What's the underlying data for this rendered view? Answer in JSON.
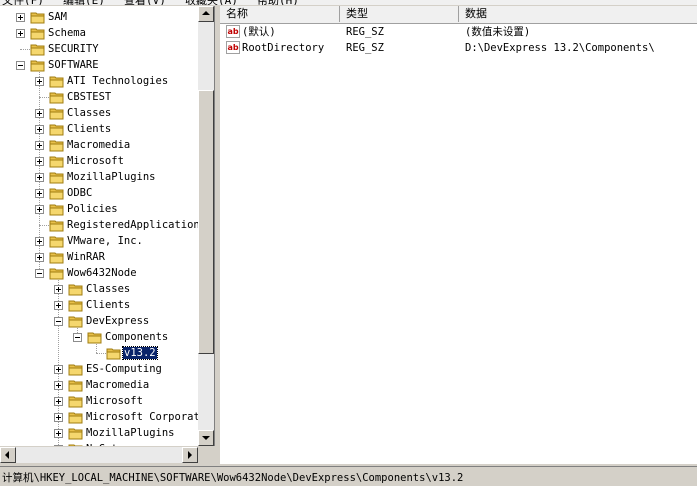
{
  "menubar": {
    "items": [
      "文件(F)",
      "编辑(E)",
      "查看(V)",
      "收藏夹(A)",
      "帮助(H)"
    ]
  },
  "tree": {
    "nodes": [
      {
        "label": "SAM",
        "level": 1,
        "expander": "plus"
      },
      {
        "label": "Schema",
        "level": 1,
        "expander": "plus"
      },
      {
        "label": "SECURITY",
        "level": 1,
        "expander": "none"
      },
      {
        "label": "SOFTWARE",
        "level": 1,
        "expander": "minus"
      },
      {
        "label": "ATI Technologies",
        "level": 2,
        "expander": "plus"
      },
      {
        "label": "CBSTEST",
        "level": 2,
        "expander": "none"
      },
      {
        "label": "Classes",
        "level": 2,
        "expander": "plus"
      },
      {
        "label": "Clients",
        "level": 2,
        "expander": "plus"
      },
      {
        "label": "Macromedia",
        "level": 2,
        "expander": "plus"
      },
      {
        "label": "Microsoft",
        "level": 2,
        "expander": "plus"
      },
      {
        "label": "MozillaPlugins",
        "level": 2,
        "expander": "plus"
      },
      {
        "label": "ODBC",
        "level": 2,
        "expander": "plus"
      },
      {
        "label": "Policies",
        "level": 2,
        "expander": "plus"
      },
      {
        "label": "RegisteredApplications",
        "level": 2,
        "expander": "none"
      },
      {
        "label": "VMware, Inc.",
        "level": 2,
        "expander": "plus"
      },
      {
        "label": "WinRAR",
        "level": 2,
        "expander": "plus"
      },
      {
        "label": "Wow6432Node",
        "level": 2,
        "expander": "minus"
      },
      {
        "label": "Classes",
        "level": 3,
        "expander": "plus"
      },
      {
        "label": "Clients",
        "level": 3,
        "expander": "plus"
      },
      {
        "label": "DevExpress",
        "level": 3,
        "expander": "minus"
      },
      {
        "label": "Components",
        "level": 4,
        "expander": "minus"
      },
      {
        "label": "v13.2",
        "level": 5,
        "expander": "none",
        "selected": true
      },
      {
        "label": "ES-Computing",
        "level": 3,
        "expander": "plus"
      },
      {
        "label": "Macromedia",
        "level": 3,
        "expander": "plus"
      },
      {
        "label": "Microsoft",
        "level": 3,
        "expander": "plus"
      },
      {
        "label": "Microsoft Corporati",
        "level": 3,
        "expander": "plus"
      },
      {
        "label": "MozillaPlugins",
        "level": 3,
        "expander": "plus"
      },
      {
        "label": "N C t",
        "level": 3,
        "expander": "plus"
      }
    ]
  },
  "columns": {
    "name": "名称",
    "type": "类型",
    "data": "数据"
  },
  "values": [
    {
      "icon": "string-value-icon",
      "icon_text": "ab",
      "name": "(默认)",
      "type": "REG_SZ",
      "data": "(数值未设置)"
    },
    {
      "icon": "string-value-icon",
      "icon_text": "ab",
      "name": "RootDirectory",
      "type": "REG_SZ",
      "data": "D:\\DevExpress 13.2\\Components\\"
    }
  ],
  "status": {
    "path": "计算机\\HKEY_LOCAL_MACHINE\\SOFTWARE\\Wow6432Node\\DevExpress\\Components\\v13.2"
  },
  "colors": {
    "selection": "#0a246a",
    "folder": "#e8c04a",
    "icon_red": "#c00000"
  }
}
